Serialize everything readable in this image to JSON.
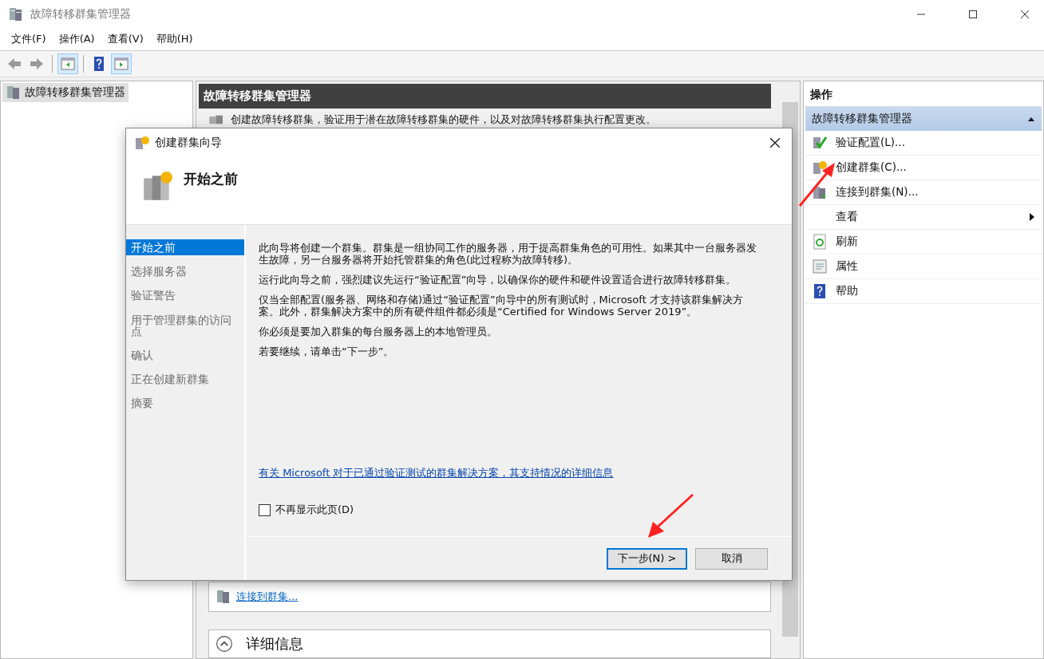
{
  "window": {
    "title": "故障转移群集管理器"
  },
  "menu": [
    "文件(F)",
    "操作(A)",
    "查看(V)",
    "帮助(H)"
  ],
  "tree": [
    {
      "label": "故障转移群集管理器",
      "selected": true
    }
  ],
  "main": {
    "header": "故障转移群集管理器",
    "description": "创建故障转移群集，验证用于潜在故障转移群集的硬件，以及对故障转移群集执行配置更改。",
    "links": [
      "连接到群集..."
    ],
    "sections": [
      {
        "label": "详细信息",
        "expanded": true
      }
    ]
  },
  "actions": {
    "title": "操作",
    "group": {
      "label": "故障转移群集管理器",
      "expanded": true
    },
    "items": [
      {
        "label": "验证配置(L)...",
        "kind": "validate"
      },
      {
        "label": "创建群集(C)...",
        "kind": "create"
      },
      {
        "label": "连接到群集(N)...",
        "kind": "connect"
      },
      {
        "label": "查看",
        "kind": "submenu"
      },
      {
        "label": "刷新",
        "kind": "refresh"
      },
      {
        "label": "属性",
        "kind": "properties"
      },
      {
        "label": "帮助",
        "kind": "help"
      }
    ]
  },
  "dialog": {
    "title": "创建群集向导",
    "page_title": "开始之前",
    "steps": [
      {
        "label": "开始之前",
        "selected": true
      },
      {
        "label": "选择服务器",
        "selected": false
      },
      {
        "label": "验证警告",
        "selected": false
      },
      {
        "label": "用于管理群集的访问点",
        "selected": false
      },
      {
        "label": "确认",
        "selected": false
      },
      {
        "label": "正在创建新群集",
        "selected": false
      },
      {
        "label": "摘要",
        "selected": false
      }
    ],
    "paragraphs": [
      "此向导将创建一个群集。群集是一组协同工作的服务器，用于提高群集角色的可用性。如果其中一台服务器发生故障，另一台服务器将开始托管群集的角色(此过程称为故障转移)。",
      "运行此向导之前，强烈建议先运行“验证配置”向导，以确保你的硬件和硬件设置适合进行故障转移群集。",
      "仅当全部配置(服务器、网络和存储)通过“验证配置”向导中的所有测试时，Microsoft 才支持该群集解决方案。此外，群集解决方案中的所有硬件组件都必须是“Certified for Windows Server 2019”。",
      "你必须是要加入群集的每台服务器上的本地管理员。",
      "若要继续，请单击“下一步”。"
    ],
    "link": "有关 Microsoft 对于已通过验证测试的群集解决方案，其支持情况的详细信息",
    "checkbox": {
      "label": "不再显示此页(D)",
      "checked": false
    },
    "buttons": [
      {
        "label": "下一步(N) >",
        "default": true
      },
      {
        "label": "取消",
        "default": false
      }
    ]
  }
}
